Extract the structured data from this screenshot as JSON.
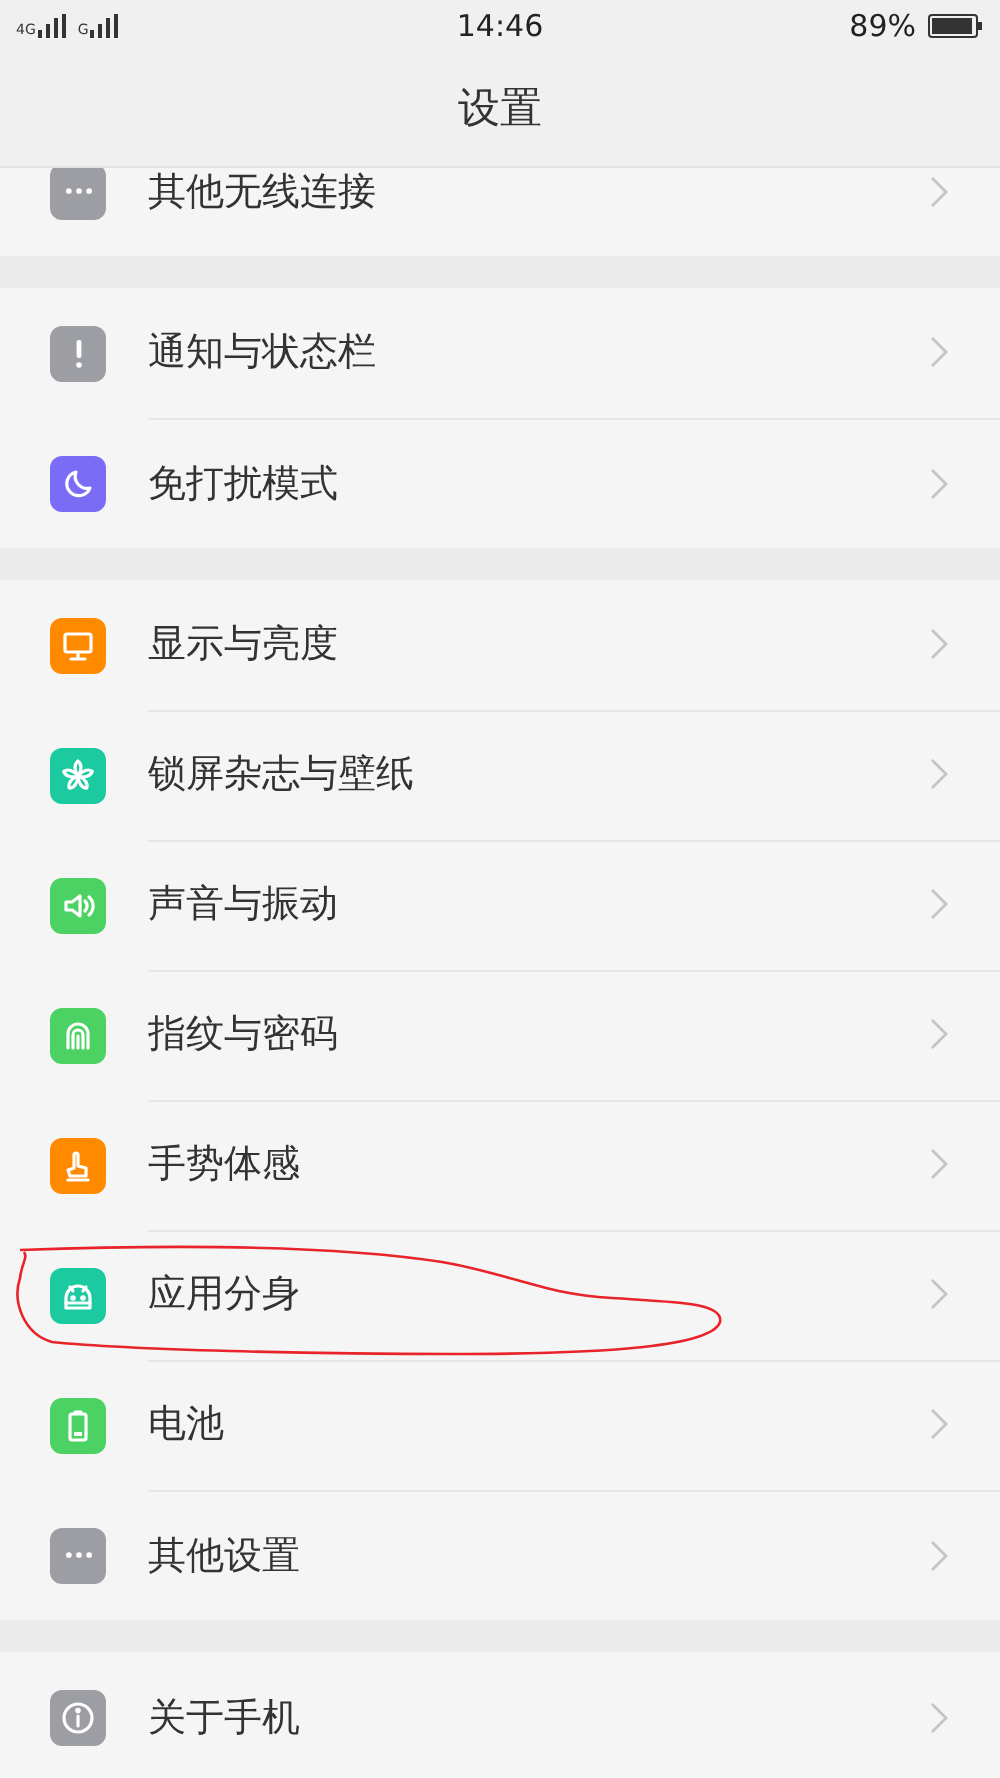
{
  "status_bar": {
    "network_1": "4G",
    "network_2": "G",
    "time": "14:46",
    "battery": "89%"
  },
  "header": {
    "title": "设置"
  },
  "sections": [
    {
      "items": [
        {
          "label": "其他无线连接",
          "kind": "dots",
          "color": "#9c9ea3",
          "annotated": false
        }
      ]
    },
    {
      "items": [
        {
          "label": "通知与状态栏",
          "kind": "exclaim",
          "color": "#9c9ea3",
          "annotated": false
        },
        {
          "label": "免打扰模式",
          "kind": "moon",
          "color": "#7a6cf4",
          "annotated": false
        }
      ]
    },
    {
      "items": [
        {
          "label": "显示与亮度",
          "kind": "monitor",
          "color": "#ff8a00",
          "annotated": false
        },
        {
          "label": "锁屏杂志与壁纸",
          "kind": "flower",
          "color": "#1ccaa0",
          "annotated": false
        },
        {
          "label": "声音与振动",
          "kind": "speaker",
          "color": "#4cd263",
          "annotated": false
        },
        {
          "label": "指纹与密码",
          "kind": "fingerprint",
          "color": "#4cd263",
          "annotated": false
        },
        {
          "label": "手势体感",
          "kind": "hand",
          "color": "#ff8a00",
          "annotated": false
        },
        {
          "label": "应用分身",
          "kind": "android",
          "color": "#1ccaa0",
          "annotated": true
        },
        {
          "label": "电池",
          "kind": "battery",
          "color": "#4cd263",
          "annotated": false
        },
        {
          "label": "其他设置",
          "kind": "dots",
          "color": "#9c9ea3",
          "annotated": false
        }
      ]
    },
    {
      "items": [
        {
          "label": "关于手机",
          "kind": "info",
          "color": "#9c9ea3",
          "annotated": false
        }
      ]
    }
  ]
}
